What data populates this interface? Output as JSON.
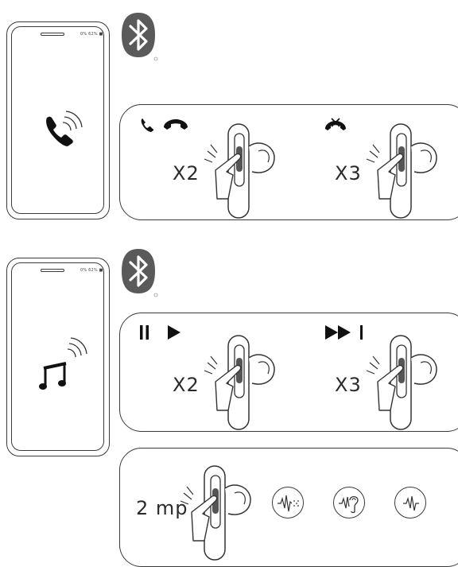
{
  "phone_status": "0% 62% ■",
  "sections": {
    "call": {
      "icon": "phone-call-icon",
      "double_tap": {
        "actions": [
          "answer-call-icon",
          "hang-up-icon"
        ],
        "count": "X2"
      },
      "triple_tap": {
        "actions": [
          "reject-call-icon"
        ],
        "count": "X3"
      }
    },
    "music": {
      "icon": "music-note-icon",
      "double_tap": {
        "actions": [
          "pause-icon",
          "play-icon"
        ],
        "count": "X2"
      },
      "triple_tap": {
        "actions": [
          "next-track-icon"
        ],
        "count": "X3"
      }
    },
    "noise_modes": {
      "hold_label": "2 mp",
      "modes": [
        "noise-cancel-icon",
        "transparency-icon",
        "off-icon"
      ]
    }
  },
  "colors": {
    "line": "#3a3a3a",
    "bluetooth_badge": "#5a5a5a"
  }
}
